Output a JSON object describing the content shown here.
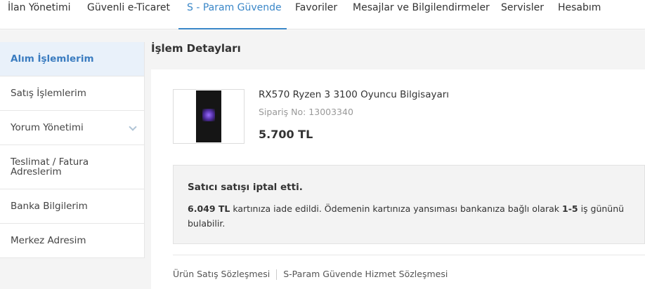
{
  "nav": {
    "items": [
      "İlan Yönetimi",
      "Güvenli e-Ticaret",
      "S - Param Güvende",
      "Favoriler",
      "Mesajlar ve Bilgilendirmeler",
      "Servisler",
      "Hesabım"
    ],
    "active_color": "#3a87c8"
  },
  "sidebar": {
    "items": [
      "Alım İşlemlerim",
      "Satış İşlemlerim",
      "Yorum Yönetimi",
      "Teslimat / Fatura Adreslerim",
      "Banka Bilgilerim",
      "Merkez Adresim"
    ],
    "active": "Alım İşlemlerim"
  },
  "page": {
    "title": "İşlem Detayları"
  },
  "product": {
    "title": "RX570 Ryzen 3 3100 Oyuncu Bilgisayarı",
    "order_label": "Sipariş No: 13003340",
    "price": "5.700 TL"
  },
  "notice": {
    "title": "Satıcı satışı iptal etti.",
    "amount": "6.049 TL",
    "text_part1": " kartınıza iade edildi. Ödemenin kartınıza yansıması bankanıza bağlı olarak ",
    "range": "1-5",
    "text_part2": " iş gününü bulabilir."
  },
  "footer": {
    "link1": "Ürün Satış Sözleşmesi",
    "link2": "S-Param Güvende Hizmet Sözleşmesi"
  }
}
